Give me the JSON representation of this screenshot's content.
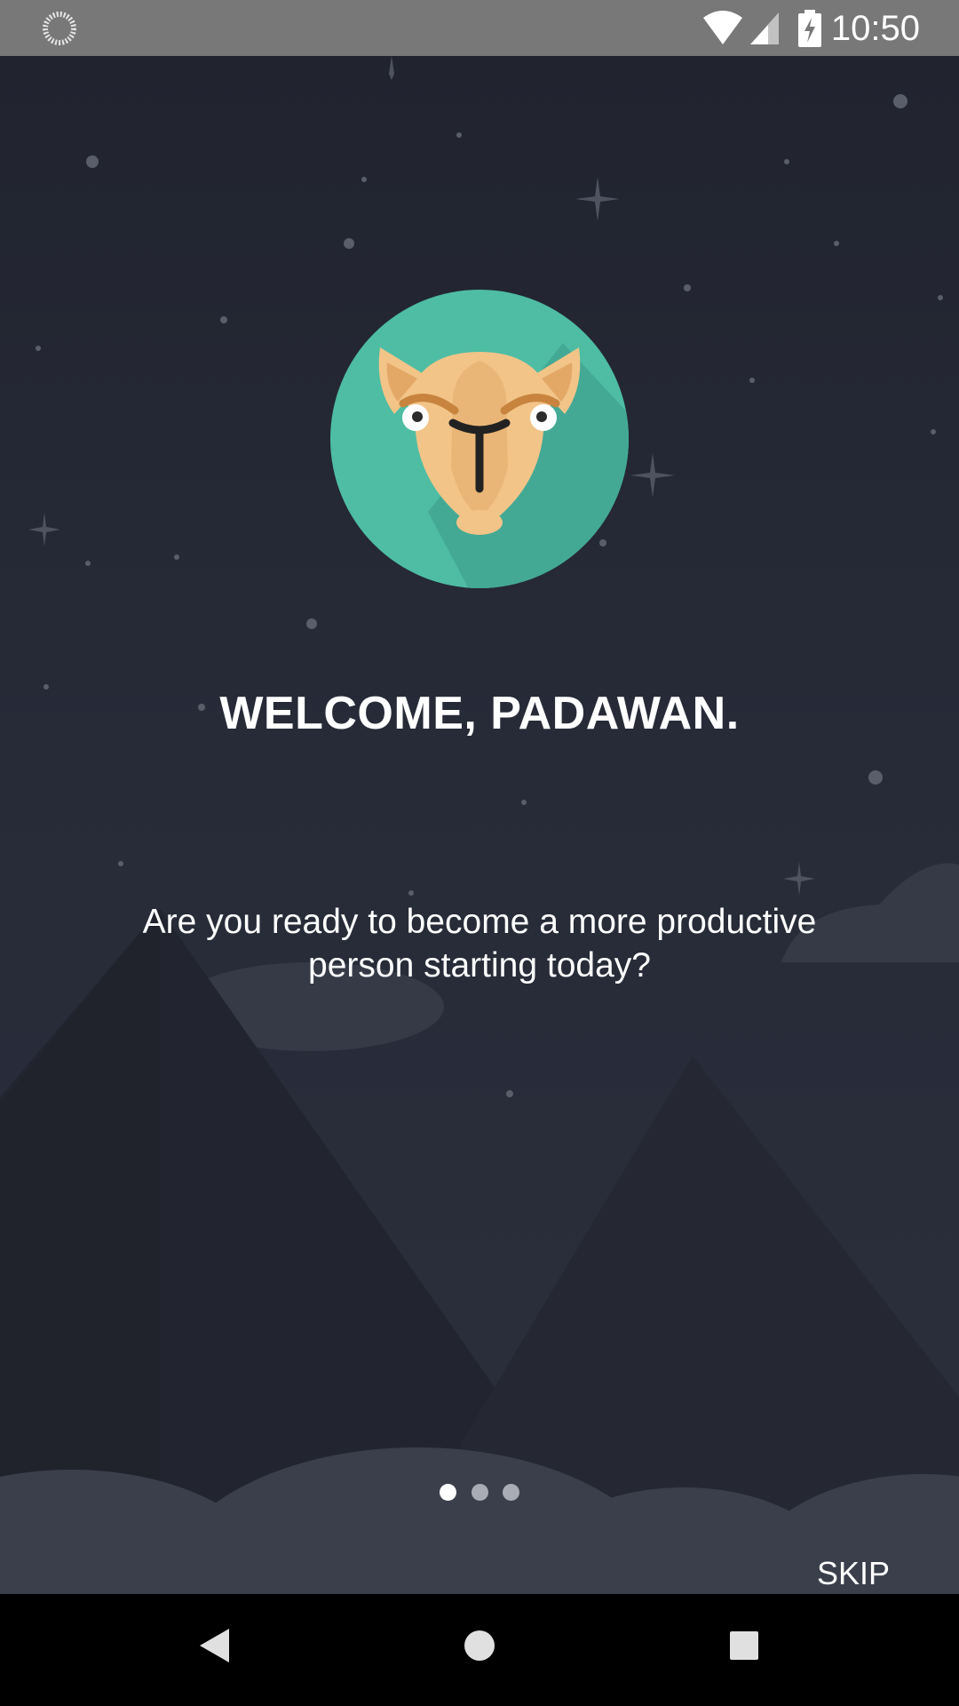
{
  "status_bar": {
    "time": "10:50",
    "icons": [
      "loading-icon",
      "wifi-icon",
      "signal-icon",
      "battery-charging-icon"
    ]
  },
  "onboarding": {
    "logo": "camel-logo-icon",
    "title": "WELCOME, PADAWAN.",
    "subtitle": "Are you ready to become a more productive person starting today?",
    "pages_total": 3,
    "active_page": 1,
    "skip_label": "SKIP"
  },
  "nav_bar": {
    "buttons": [
      "back-icon",
      "home-icon",
      "recents-icon"
    ]
  },
  "colors": {
    "background": "#252936",
    "logo_circle": "#4ebda4",
    "camel": "#f2c488",
    "text": "#ffffff"
  }
}
